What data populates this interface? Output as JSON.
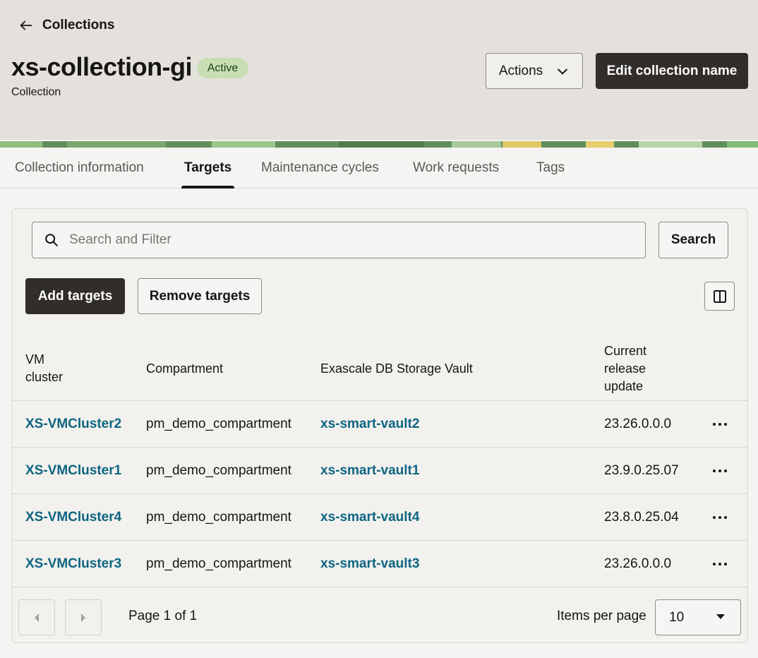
{
  "header": {
    "back_label": "Collections",
    "title": "xs-collection-gi",
    "status": "Active",
    "subtitle": "Collection",
    "actions_label": "Actions",
    "edit_label": "Edit collection name"
  },
  "tabs": [
    {
      "label": "Collection information"
    },
    {
      "label": "Targets",
      "active": true
    },
    {
      "label": "Maintenance cycles"
    },
    {
      "label": "Work requests"
    },
    {
      "label": "Tags"
    }
  ],
  "search": {
    "placeholder": "Search and Filter",
    "button_label": "Search"
  },
  "toolbar": {
    "add_label": "Add targets",
    "remove_label": "Remove targets"
  },
  "table": {
    "columns": [
      "VM cluster",
      "Compartment",
      "Exascale DB Storage Vault",
      "Current release update"
    ],
    "rows": [
      {
        "vm_cluster": "XS-VMCluster2",
        "compartment": "pm_demo_compartment",
        "vault": "xs-smart-vault2",
        "release": "23.26.0.0.0"
      },
      {
        "vm_cluster": "XS-VMCluster1",
        "compartment": "pm_demo_compartment",
        "vault": "xs-smart-vault1",
        "release": "23.9.0.25.07"
      },
      {
        "vm_cluster": "XS-VMCluster4",
        "compartment": "pm_demo_compartment",
        "vault": "xs-smart-vault4",
        "release": "23.8.0.25.04"
      },
      {
        "vm_cluster": "XS-VMCluster3",
        "compartment": "pm_demo_compartment",
        "vault": "xs-smart-vault3",
        "release": "23.26.0.0.0"
      }
    ]
  },
  "pagination": {
    "page_info": "Page 1 of 1",
    "items_per_page_label": "Items per page",
    "items_per_page_value": "10"
  },
  "colors": {
    "link": "#0e6581",
    "primary_button": "#312d2a",
    "status_badge": "#c7dfb2"
  }
}
